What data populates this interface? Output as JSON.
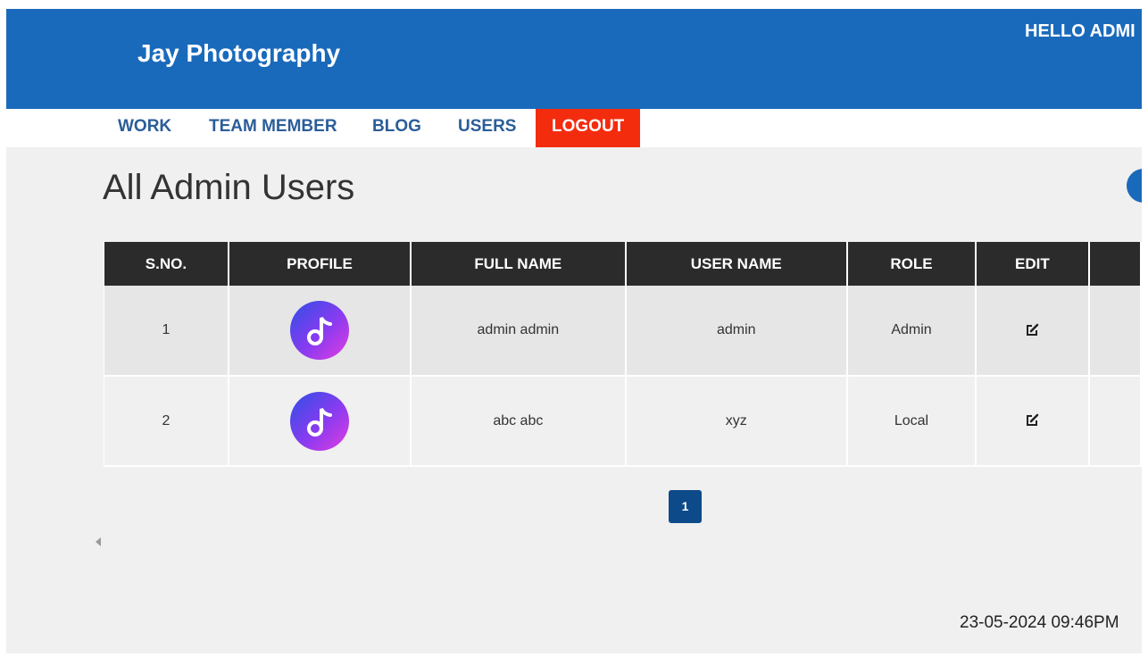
{
  "header": {
    "brand": "Jay Photography",
    "greeting": "HELLO ADMI"
  },
  "nav": {
    "items": [
      {
        "label": "WORK"
      },
      {
        "label": "TEAM MEMBER"
      },
      {
        "label": "BLOG"
      },
      {
        "label": "USERS"
      },
      {
        "label": "LOGOUT"
      }
    ]
  },
  "page": {
    "title": "All Admin Users"
  },
  "table": {
    "headers": [
      "S.NO.",
      "PROFILE",
      "FULL NAME",
      "USER NAME",
      "ROLE",
      "EDIT",
      ""
    ],
    "rows": [
      {
        "sno": "1",
        "profile_icon": "music-note-icon",
        "full_name": "admin admin",
        "user_name": "admin",
        "role": "Admin",
        "edit_icon": "edit-icon"
      },
      {
        "sno": "2",
        "profile_icon": "music-note-icon",
        "full_name": "abc abc",
        "user_name": "xyz",
        "role": "Local",
        "edit_icon": "edit-icon"
      }
    ]
  },
  "pagination": {
    "current_page": "1"
  },
  "footer": {
    "timestamp": "23-05-2024 09:46PM"
  },
  "colors": {
    "header_bg": "#1a6abb",
    "logout_bg": "#f42c0e",
    "table_header_bg": "#2b2b2b",
    "pager_bg": "#0d4a8a"
  }
}
